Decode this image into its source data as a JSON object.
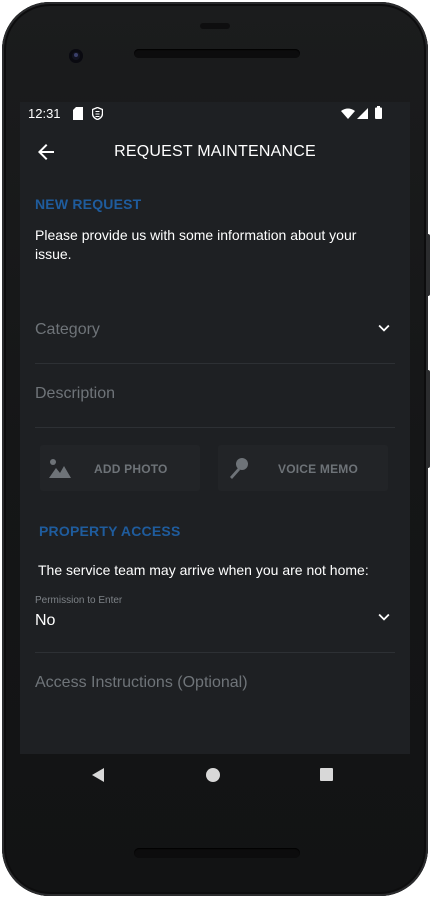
{
  "statusbar": {
    "time": "12:31",
    "icons_left": [
      "sd-card-icon",
      "vpn-icon"
    ],
    "icons_right": [
      "wifi-icon",
      "cell-signal-icon",
      "battery-icon"
    ]
  },
  "appbar": {
    "title": "REQUEST MAINTENANCE",
    "back_icon": "arrow-left-icon"
  },
  "new_request": {
    "heading": "NEW REQUEST",
    "intro": "Please provide us with some information about your issue.",
    "category_label": "Category",
    "description_label": "Description",
    "add_photo_label": "ADD PHOTO",
    "voice_memo_label": "VOICE MEMO"
  },
  "property_access": {
    "heading": "PROPERTY ACCESS",
    "note": "The service team may arrive when you are not home:",
    "permission_label": "Permission to Enter",
    "permission_value": "No",
    "access_instructions_label": "Access Instructions (Optional)"
  },
  "colors": {
    "screen_bg": "#1e2023",
    "accent": "#1f5c9d",
    "muted_text": "#6f7479",
    "divider": "#2d3034"
  }
}
